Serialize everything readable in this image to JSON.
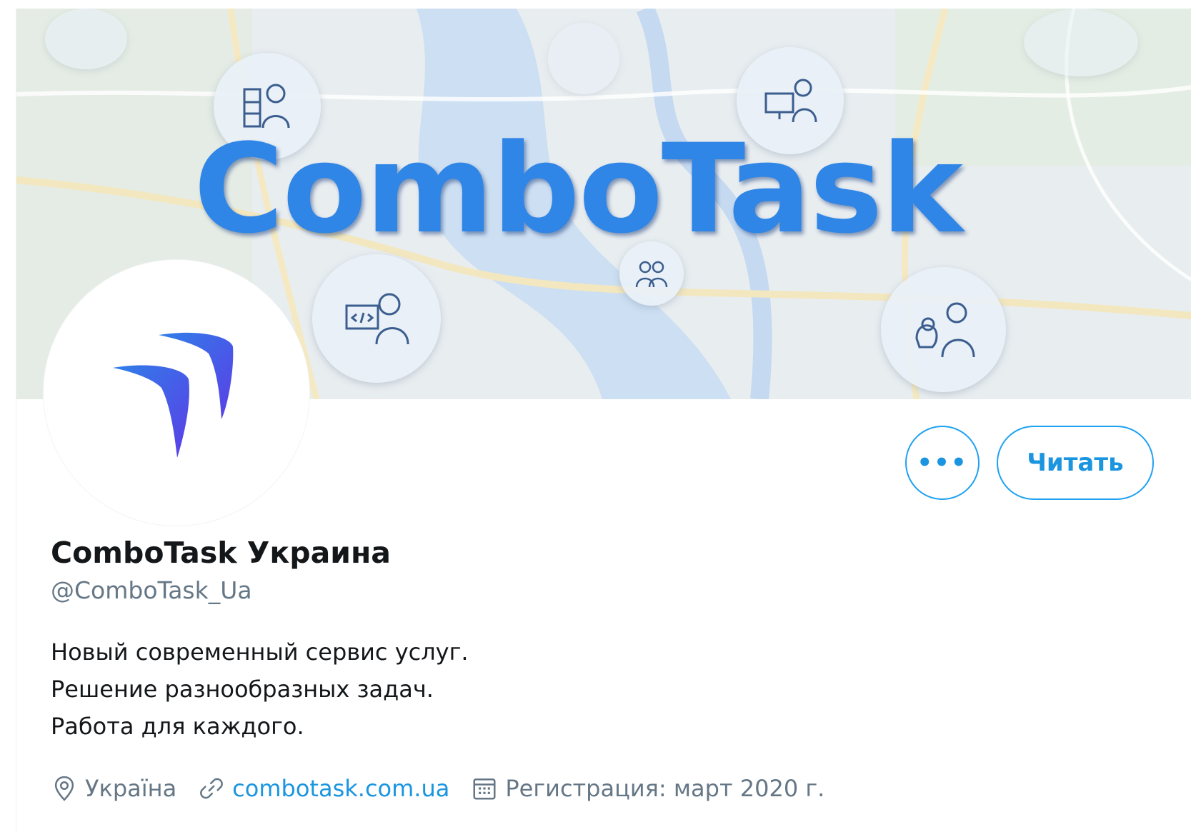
{
  "profile": {
    "banner_logo_text": "ComboTask",
    "display_name": "ComboTask Украина",
    "handle": "@ComboTask_Ua",
    "bio": [
      "Новый современный сервис услуг.",
      "Решение разнообразных задач.",
      "Работа для каждого."
    ],
    "location": "Україна",
    "website": "combotask.com.ua",
    "joined": "Регистрация: март 2020 г."
  },
  "actions": {
    "more_label": "•••",
    "follow_label": "Читать"
  },
  "colors": {
    "accent": "#1da1f2",
    "link": "#1b95e0",
    "banner_text": "#2f86e6",
    "avatar_logo_gradient": [
      "#2f7fe9",
      "#5b3ee6"
    ]
  },
  "icons": {
    "location": "location-pin-icon",
    "website": "link-icon",
    "joined": "calendar-icon"
  }
}
